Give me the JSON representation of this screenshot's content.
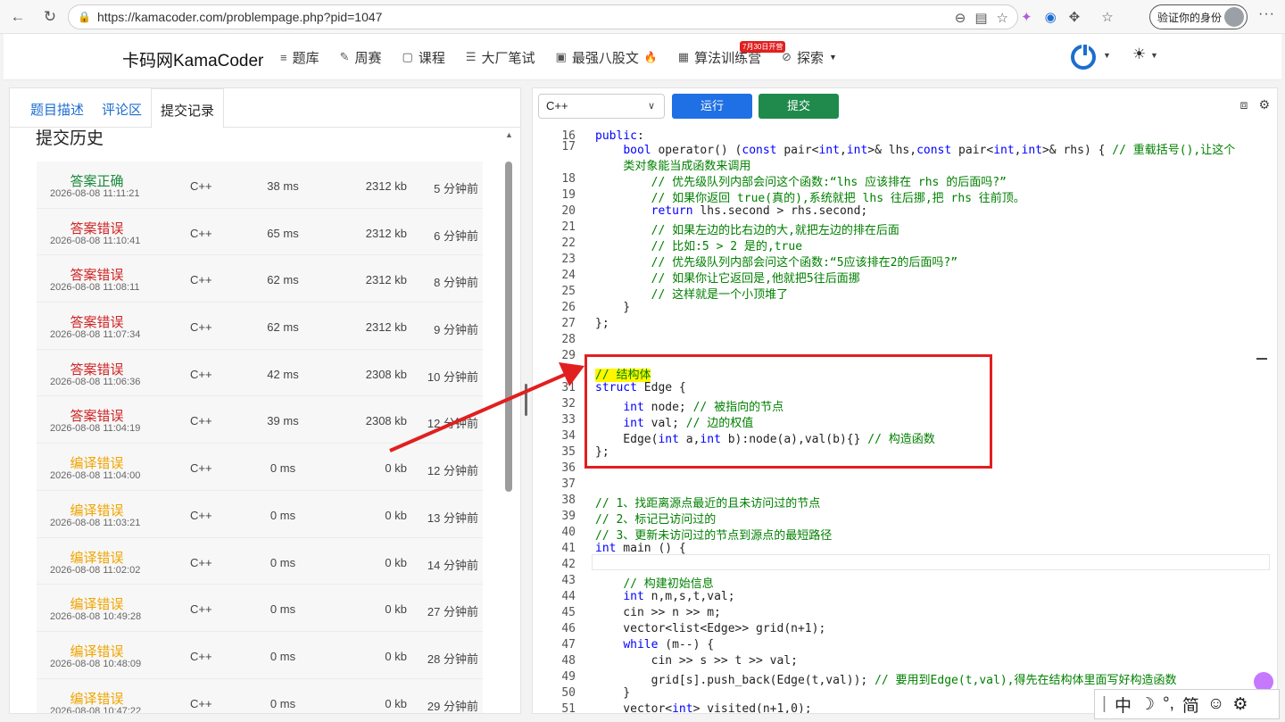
{
  "browser": {
    "url": "https://kamacoder.com/problempage.php?pid=1047",
    "profile_label": "验证你的身份"
  },
  "site": {
    "brand": "卡码网KamaCoder",
    "nav": [
      {
        "icon": "list-icon",
        "label": "题库"
      },
      {
        "icon": "pencil-icon",
        "label": "周赛"
      },
      {
        "icon": "book-icon",
        "label": "课程"
      },
      {
        "icon": "doc-icon",
        "label": "大厂笔试"
      },
      {
        "icon": "box-icon",
        "label": "最强八股文"
      },
      {
        "icon": "calendar-icon",
        "label": "算法训练营"
      },
      {
        "icon": "compass-icon",
        "label": "探索"
      }
    ],
    "badge": "7月30日开营"
  },
  "left": {
    "tabs": [
      "题目描述",
      "评论区",
      "提交记录"
    ],
    "active_tab": "提交记录",
    "history_title": "提交历史",
    "submissions": [
      {
        "status": "答案正确",
        "kind": "ok",
        "time": "2026-08-08 11:11:21",
        "lang": "C++",
        "ms": "38 ms",
        "kb": "2312 kb",
        "ago": "5 分钟前"
      },
      {
        "status": "答案错误",
        "kind": "wa",
        "time": "2026-08-08 11:10:41",
        "lang": "C++",
        "ms": "65 ms",
        "kb": "2312 kb",
        "ago": "6 分钟前"
      },
      {
        "status": "答案错误",
        "kind": "wa",
        "time": "2026-08-08 11:08:11",
        "lang": "C++",
        "ms": "62 ms",
        "kb": "2312 kb",
        "ago": "8 分钟前"
      },
      {
        "status": "答案错误",
        "kind": "wa",
        "time": "2026-08-08 11:07:34",
        "lang": "C++",
        "ms": "62 ms",
        "kb": "2312 kb",
        "ago": "9 分钟前"
      },
      {
        "status": "答案错误",
        "kind": "wa",
        "time": "2026-08-08 11:06:36",
        "lang": "C++",
        "ms": "42 ms",
        "kb": "2308 kb",
        "ago": "10 分钟前"
      },
      {
        "status": "答案错误",
        "kind": "wa",
        "time": "2026-08-08 11:04:19",
        "lang": "C++",
        "ms": "39 ms",
        "kb": "2308 kb",
        "ago": "12 分钟前"
      },
      {
        "status": "编译错误",
        "kind": "ce",
        "time": "2026-08-08 11:04:00",
        "lang": "C++",
        "ms": "0 ms",
        "kb": "0 kb",
        "ago": "12 分钟前"
      },
      {
        "status": "编译错误",
        "kind": "ce",
        "time": "2026-08-08 11:03:21",
        "lang": "C++",
        "ms": "0 ms",
        "kb": "0 kb",
        "ago": "13 分钟前"
      },
      {
        "status": "编译错误",
        "kind": "ce",
        "time": "2026-08-08 11:02:02",
        "lang": "C++",
        "ms": "0 ms",
        "kb": "0 kb",
        "ago": "14 分钟前"
      },
      {
        "status": "编译错误",
        "kind": "ce",
        "time": "2026-08-08 10:49:28",
        "lang": "C++",
        "ms": "0 ms",
        "kb": "0 kb",
        "ago": "27 分钟前"
      },
      {
        "status": "编译错误",
        "kind": "ce",
        "time": "2026-08-08 10:48:09",
        "lang": "C++",
        "ms": "0 ms",
        "kb": "0 kb",
        "ago": "28 分钟前"
      },
      {
        "status": "编译错误",
        "kind": "ce",
        "time": "2026-08-08 10:47:22",
        "lang": "C++",
        "ms": "0 ms",
        "kb": "0 kb",
        "ago": "29 分钟前"
      }
    ]
  },
  "right": {
    "language": "C++",
    "run_label": "运行",
    "submit_label": "提交",
    "code_lines": [
      {
        "n": "16",
        "html": "<span class='kw'>public</span>:"
      },
      {
        "n": "17",
        "html": "    <span class='ty'>bool</span> operator() (<span class='ty'>const</span> pair&lt;<span class='ty'>int</span>,<span class='ty'>int</span>&gt;&amp; lhs,<span class='ty'>const</span> pair&lt;<span class='ty'>int</span>,<span class='ty'>int</span>&gt;&amp; rhs) { <span class='cm'>// 重载括号(),让这个</span>"
      },
      {
        "n": "",
        "html": "    <span class='cm'>类对象能当成函数来调用</span>"
      },
      {
        "n": "18",
        "html": "        <span class='cm'>// 优先级队列内部会问这个函数:“lhs 应该排在 rhs 的后面吗?”</span>"
      },
      {
        "n": "19",
        "html": "        <span class='cm'>// 如果你返回 true(真的),系统就把 lhs 往后挪,把 rhs 往前顶。</span>"
      },
      {
        "n": "20",
        "html": "        <span class='kw'>return</span> lhs.second &gt; rhs.second;"
      },
      {
        "n": "21",
        "html": "        <span class='cm'>// 如果左边的比右边的大,就把左边的排在后面</span>"
      },
      {
        "n": "22",
        "html": "        <span class='cm'>// 比如:5 &gt; 2 是的,true</span>"
      },
      {
        "n": "23",
        "html": "        <span class='cm'>// 优先级队列内部会问这个函数:“5应该排在2的后面吗?”</span>"
      },
      {
        "n": "24",
        "html": "        <span class='cm'>// 如果你让它返回是,他就把5往后面挪</span>"
      },
      {
        "n": "25",
        "html": "        <span class='cm'>// 这样就是一个小顶堆了</span>"
      },
      {
        "n": "26",
        "html": "    }"
      },
      {
        "n": "27",
        "html": "};"
      },
      {
        "n": "28",
        "html": ""
      },
      {
        "n": "29",
        "html": ""
      },
      {
        "n": "30",
        "html": "<span class='cm hl'>// 结构体</span>"
      },
      {
        "n": "31",
        "html": "<span class='kw'>struct</span> Edge {"
      },
      {
        "n": "32",
        "html": "    <span class='ty'>int</span> node; <span class='cm'>// 被指向的节点</span>"
      },
      {
        "n": "33",
        "html": "    <span class='ty'>int</span> val; <span class='cm'>// 边的权值</span>"
      },
      {
        "n": "34",
        "html": "    Edge(<span class='ty'>int</span> a,<span class='ty'>int</span> b):node(a),val(b){} <span class='cm'>// 构造函数</span>"
      },
      {
        "n": "35",
        "html": "};"
      },
      {
        "n": "36",
        "html": ""
      },
      {
        "n": "37",
        "html": ""
      },
      {
        "n": "38",
        "html": "<span class='cm'>// 1、找距离源点最近的且未访问过的节点</span>"
      },
      {
        "n": "39",
        "html": "<span class='cm'>// 2、标记已访问过的</span>"
      },
      {
        "n": "40",
        "html": "<span class='cm'>// 3、更新未访问过的节点到源点的最短路径</span>"
      },
      {
        "n": "41",
        "html": "<span class='ty'>int</span> main () {"
      },
      {
        "n": "42",
        "html": ""
      },
      {
        "n": "43",
        "html": "    <span class='cm'>// 构建初始信息</span>"
      },
      {
        "n": "44",
        "html": "    <span class='ty'>int</span> n,m,s,t,val;"
      },
      {
        "n": "45",
        "html": "    cin &gt;&gt; n &gt;&gt; m;"
      },
      {
        "n": "46",
        "html": "    vector&lt;list&lt;Edge&gt;&gt; grid(n+1);"
      },
      {
        "n": "47",
        "html": "    <span class='kw'>while</span> (m--) {"
      },
      {
        "n": "48",
        "html": "        cin &gt;&gt; s &gt;&gt; t &gt;&gt; val;"
      },
      {
        "n": "49",
        "html": "        grid[s].push_back(Edge(t,val)); <span class='cm'>// 要用到Edge(t,val),得先在结构体里面写好构造函数</span>"
      },
      {
        "n": "50",
        "html": "    }"
      },
      {
        "n": "51",
        "html": "    vector&lt;<span class='ty'>int</span>&gt; visited(n+1,0);"
      }
    ]
  },
  "ime": [
    "中",
    "☽",
    "°,",
    "简",
    "☺",
    "⚙"
  ]
}
